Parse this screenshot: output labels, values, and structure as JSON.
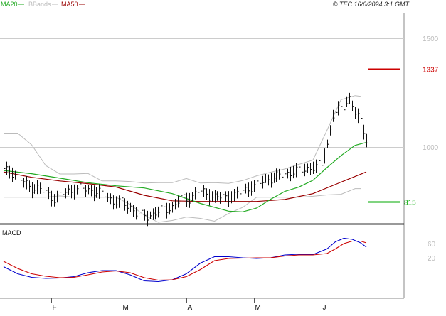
{
  "header": {
    "copyright": "© TEC 16/6/2024 3:1 GMT"
  },
  "chart_data": [
    {
      "type": "line",
      "title": "",
      "legend_placement": "top-left",
      "legend": [
        {
          "label": "MA20",
          "color": "#22aa22"
        },
        {
          "label": "BBands",
          "color": "#bbbbbb"
        },
        {
          "label": "MA50",
          "color": "#990000"
        }
      ],
      "y_scale": "log",
      "ylim": [
        755,
        1650
      ],
      "y_ticks": [
        {
          "value": 1500,
          "label": "1500"
        },
        {
          "value": 1000,
          "label": "1000"
        }
      ],
      "x_ticks": [
        "F",
        "M",
        "A",
        "M",
        "J"
      ],
      "colors": {
        "price": "#111111",
        "ma20": "#22aa22",
        "ma50": "#990000",
        "bbands": "#bbbbbb",
        "grid": "#cccccc"
      },
      "price_levels": [
        {
          "label": "1337",
          "value": 1337,
          "color": "#cc0000"
        },
        {
          "label": "815",
          "value": 815,
          "color": "#00aa00"
        }
      ],
      "n_days": 130,
      "series": [
        {
          "name": "MA20",
          "key": "ma20",
          "values": [
            [
              0,
              916
            ],
            [
              10,
              905
            ],
            [
              20,
              890
            ],
            [
              30,
              875
            ],
            [
              40,
              865
            ],
            [
              50,
              858
            ],
            [
              60,
              840
            ],
            [
              70,
              810
            ],
            [
              80,
              787
            ],
            [
              85,
              785
            ],
            [
              90,
              796
            ],
            [
              95,
              823
            ],
            [
              100,
              847
            ],
            [
              105,
              861
            ],
            [
              110,
              883
            ],
            [
              115,
              926
            ],
            [
              120,
              968
            ],
            [
              125,
              1006
            ],
            [
              129,
              1017
            ]
          ]
        },
        {
          "name": "MA50",
          "key": "ma50",
          "values": [
            [
              0,
              911
            ],
            [
              10,
              893
            ],
            [
              20,
              881
            ],
            [
              30,
              872
            ],
            [
              40,
              861
            ],
            [
              50,
              835
            ],
            [
              60,
              818
            ],
            [
              70,
              816
            ],
            [
              80,
              816
            ],
            [
              90,
              816
            ],
            [
              100,
              822
            ],
            [
              110,
              840
            ],
            [
              120,
              877
            ],
            [
              129,
              911
            ]
          ]
        },
        {
          "name": "BBands",
          "key": "bb_upper",
          "values": [
            [
              0,
              1053
            ],
            [
              5,
              1053
            ],
            [
              10,
              1008
            ],
            [
              15,
              933
            ],
            [
              20,
              904
            ],
            [
              25,
              904
            ],
            [
              30,
              906
            ],
            [
              35,
              881
            ],
            [
              40,
              881
            ],
            [
              45,
              879
            ],
            [
              50,
              874
            ],
            [
              55,
              875
            ],
            [
              60,
              875
            ],
            [
              65,
              889
            ],
            [
              70,
              874
            ],
            [
              75,
              875
            ],
            [
              80,
              873
            ],
            [
              85,
              882
            ],
            [
              90,
              898
            ],
            [
              95,
              910
            ],
            [
              100,
              921
            ],
            [
              105,
              937
            ],
            [
              110,
              952
            ],
            [
              115,
              1064
            ],
            [
              120,
              1193
            ],
            [
              125,
              1211
            ],
            [
              127,
              1208
            ]
          ]
        },
        {
          "name": "BBands",
          "key": "bb_lower",
          "values": [
            [
              0,
              829
            ],
            [
              5,
              829
            ],
            [
              10,
              829
            ],
            [
              15,
              829
            ],
            [
              20,
              833
            ],
            [
              25,
              829
            ],
            [
              30,
              829
            ],
            [
              35,
              829
            ],
            [
              40,
              829
            ],
            [
              45,
              807
            ],
            [
              50,
              775
            ],
            [
              55,
              755
            ],
            [
              60,
              760
            ],
            [
              65,
              770
            ],
            [
              70,
              766
            ],
            [
              75,
              758
            ],
            [
              80,
              780
            ],
            [
              85,
              798
            ],
            [
              90,
              829
            ],
            [
              95,
              829
            ],
            [
              100,
              829
            ],
            [
              105,
              829
            ],
            [
              110,
              832
            ],
            [
              115,
              836
            ],
            [
              120,
              838
            ],
            [
              125,
              856
            ],
            [
              127,
              856
            ]
          ]
        },
        {
          "name": "Price",
          "key": "price",
          "values": [
            [
              0,
              915
            ],
            [
              3,
              910
            ],
            [
              6,
              886
            ],
            [
              9,
              861
            ],
            [
              12,
              858
            ],
            [
              15,
              843
            ],
            [
              18,
              825
            ],
            [
              21,
              840
            ],
            [
              24,
              850
            ],
            [
              27,
              857
            ],
            [
              30,
              851
            ],
            [
              33,
              846
            ],
            [
              36,
              836
            ],
            [
              39,
              817
            ],
            [
              42,
              813
            ],
            [
              45,
              798
            ],
            [
              48,
              775
            ],
            [
              51,
              772
            ],
            [
              54,
              782
            ],
            [
              57,
              792
            ],
            [
              60,
              799
            ],
            [
              63,
              824
            ],
            [
              66,
              825
            ],
            [
              69,
              848
            ],
            [
              72,
              840
            ],
            [
              75,
              830
            ],
            [
              78,
              828
            ],
            [
              81,
              831
            ],
            [
              84,
              843
            ],
            [
              87,
              858
            ],
            [
              90,
              867
            ],
            [
              93,
              885
            ],
            [
              96,
              892
            ],
            [
              99,
              901
            ],
            [
              102,
              910
            ],
            [
              105,
              915
            ],
            [
              108,
              923
            ],
            [
              111,
              928
            ],
            [
              113,
              936
            ],
            [
              115,
              1010
            ],
            [
              117,
              1125
            ],
            [
              119,
              1147
            ],
            [
              121,
              1167
            ],
            [
              123,
              1200
            ],
            [
              125,
              1135
            ],
            [
              127,
              1100
            ],
            [
              129,
              1030
            ]
          ]
        }
      ]
    },
    {
      "type": "line",
      "title": "MACD",
      "ylim": [
        -90,
        110
      ],
      "y_ticks": [
        {
          "value": 60,
          "label": "60"
        },
        {
          "value": 20,
          "label": "20"
        }
      ],
      "colors": {
        "macd": "#0000cc",
        "signal": "#cc0000"
      },
      "series": [
        {
          "name": "MACD",
          "key": "macd",
          "values": [
            [
              0,
              -5
            ],
            [
              5,
              -25
            ],
            [
              10,
              -35
            ],
            [
              15,
              -38
            ],
            [
              20,
              -37
            ],
            [
              25,
              -33
            ],
            [
              30,
              -22
            ],
            [
              35,
              -16
            ],
            [
              40,
              -16
            ],
            [
              45,
              -28
            ],
            [
              50,
              -45
            ],
            [
              55,
              -47
            ],
            [
              60,
              -42
            ],
            [
              65,
              -25
            ],
            [
              70,
              5
            ],
            [
              75,
              23
            ],
            [
              80,
              23
            ],
            [
              85,
              20
            ],
            [
              90,
              18
            ],
            [
              95,
              20
            ],
            [
              100,
              28
            ],
            [
              105,
              30
            ],
            [
              110,
              29
            ],
            [
              115,
              45
            ],
            [
              118,
              65
            ],
            [
              121,
              75
            ],
            [
              124,
              72
            ],
            [
              127,
              62
            ],
            [
              129,
              50
            ]
          ]
        },
        {
          "name": "Signal",
          "key": "signal",
          "values": [
            [
              0,
              10
            ],
            [
              5,
              -10
            ],
            [
              10,
              -25
            ],
            [
              15,
              -32
            ],
            [
              20,
              -36
            ],
            [
              25,
              -35
            ],
            [
              30,
              -28
            ],
            [
              35,
              -20
            ],
            [
              40,
              -17
            ],
            [
              45,
              -22
            ],
            [
              50,
              -36
            ],
            [
              55,
              -43
            ],
            [
              60,
              -42
            ],
            [
              65,
              -33
            ],
            [
              70,
              -13
            ],
            [
              75,
              12
            ],
            [
              80,
              18
            ],
            [
              85,
              19
            ],
            [
              90,
              20
            ],
            [
              95,
              20
            ],
            [
              100,
              25
            ],
            [
              105,
              28
            ],
            [
              110,
              28
            ],
            [
              115,
              32
            ],
            [
              118,
              45
            ],
            [
              121,
              60
            ],
            [
              124,
              67
            ],
            [
              127,
              67
            ],
            [
              129,
              62
            ]
          ]
        }
      ]
    }
  ]
}
